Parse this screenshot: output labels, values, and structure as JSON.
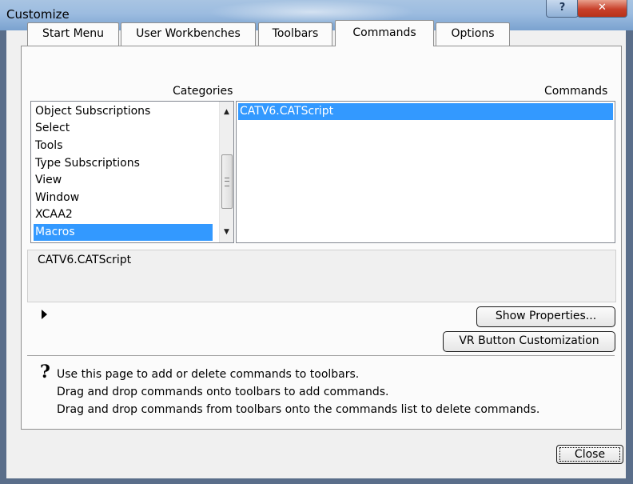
{
  "window": {
    "title": "Customize"
  },
  "tabs": [
    {
      "label": "Start Menu"
    },
    {
      "label": "User Workbenches"
    },
    {
      "label": "Toolbars"
    },
    {
      "label": "Commands"
    },
    {
      "label": "Options"
    }
  ],
  "active_tab": "Commands",
  "categories": {
    "header": "Categories",
    "items": [
      "Object Subscriptions",
      "Select",
      "Tools",
      "Type Subscriptions",
      "View",
      "Window",
      "XCAA2",
      "Macros"
    ],
    "selected": "Macros"
  },
  "commands": {
    "header": "Commands",
    "items": [
      "CATV6.CATScript"
    ],
    "selected": "CATV6.CATScript"
  },
  "description": {
    "text": "CATV6.CATScript"
  },
  "buttons": {
    "show_properties": "Show Properties...",
    "vr_button": "VR Button Customization",
    "close": "Close"
  },
  "help": {
    "line1": "Use this page to add or delete commands to toolbars.",
    "line2": "Drag and drop commands onto toolbars to add commands.",
    "line3": "Drag and drop commands from toolbars onto the commands list to delete commands."
  },
  "colors": {
    "selection": "#3399ff",
    "titlebar": "#9cbce0",
    "close_button": "#c8402a"
  },
  "icons": {
    "help": "question-icon",
    "close": "close-icon",
    "expander": "triangle-right-icon"
  }
}
